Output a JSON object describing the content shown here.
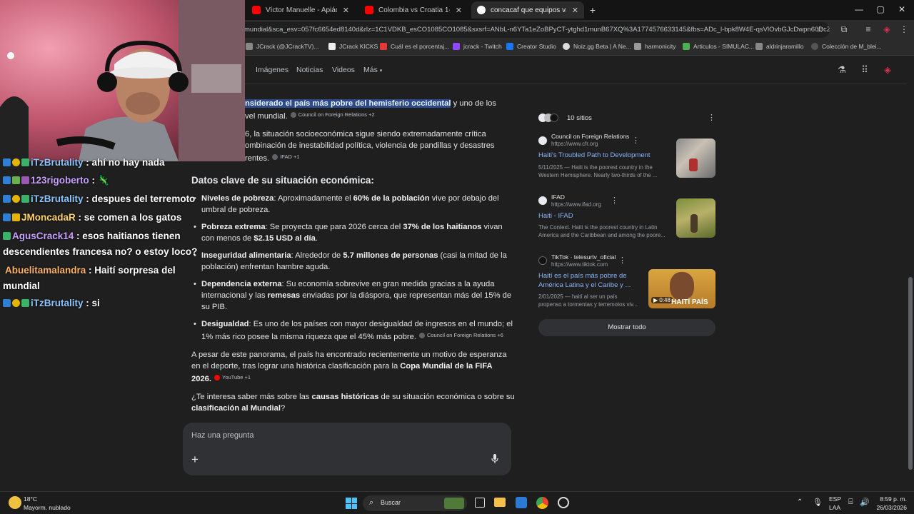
{
  "tabs": [
    {
      "title": "Víctor Manuelle - Apiádate de Mí",
      "color": "#ff0000"
    },
    {
      "title": "Colombia vs Croatia 1-2 Highlig",
      "color": "#ff0000"
    },
    {
      "title": "concacaf que equipos van al mun",
      "color": "#ffffff"
    }
  ],
  "new_tab": "+",
  "window_controls": {
    "minimize": "—",
    "maximize": "▢",
    "close": "✕"
  },
  "address": {
    "url": "mundial&sca_esv=057fc6654ed8140d&rlz=1C1VDKB_esCO1085CO1085&sxsrf=ANbL-n6YTa1eZoBPyCT-ytghd1munB67XQ%3A1774576633145&fbs=ADc_l-bpk8W4E-qsVlOvbGJcDwpn60DcZ..."
  },
  "bookmarks": [
    "JCrack (@JCrackTV)...",
    "JCrack KICKS",
    "Cuál es el porcentaj...",
    "jcrack - Twitch",
    "Creator Studio",
    "Noiz.gg Beta | A Ne...",
    "harmonicity",
    "Articulos - SIMULAC...",
    "aldrinjaramillo",
    "Colección de M_blei..."
  ],
  "google_tabs": [
    "Imágenes",
    "Noticias",
    "Videos",
    "Más"
  ],
  "answer": {
    "line1_highlight": "nsiderado el país más pobre del hemisferio occidental",
    "line1_rest": " y uno de los",
    "line2": "vel mundial.",
    "chip1": "Council on Foreign Relations +2",
    "p2_prefix": "6, la situación socioeconómica sigue siendo extremadamente crítica",
    "p2_line2": "ombinación de inestabilidad política, violencia de pandillas y desastres",
    "p2_line3": "rentes.",
    "chip2": "IFAD +1",
    "section_title": "Datos clave de su situación económica:",
    "bullets": [
      {
        "label": "Niveles de pobreza",
        "text1": ": Aproximadamente el ",
        "bold": "60% de la población",
        "text2": " vive por debajo del",
        "line2": "umbral de pobreza."
      },
      {
        "label": "Pobreza extrema",
        "text1": ": Se proyecta que para 2026 cerca del ",
        "bold": "37% de los haitianos",
        "text2": " vivan",
        "line2a": "con menos de ",
        "line2b": "$2.15 USD al día",
        "line2c": "."
      },
      {
        "label": "Inseguridad alimentaria",
        "text1": ": Alrededor de ",
        "bold": "5.7 millones de personas",
        "text2": " (casi la mitad de la",
        "line2": "población) enfrentan hambre aguda."
      },
      {
        "label": "Dependencia externa",
        "text1": ": Su economía sobrevive en gran medida gracias a la ayuda",
        "line2a": "internacional y las ",
        "line2b": "remesas",
        "line2c": " enviadas por la diáspora, que representan más del 15% de",
        "line3": "su PIB."
      },
      {
        "label": "Desigualdad",
        "text1": ": Es uno de los países con mayor desigualdad de ingresos en el mundo; el",
        "line2": "1% más rico posee la misma riqueza que el 45% más pobre.",
        "chip": "Council on Foreign Relations +6"
      }
    ],
    "p3_line1": "A pesar de este panorama, el país ha encontrado recientemente un motivo de esperanza",
    "p3_line2a": "en el deporte, tras lograr una histórica clasificación para la ",
    "p3_line2b": "Copa Mundial de la FIFA",
    "p3_line3": "2026.",
    "chip3": "YouTube +1",
    "q_line1a": "¿Te interesa saber más sobre las ",
    "q_line1b": "causas históricas",
    "q_line1c": " de su situación económica o sobre su",
    "q_line2a": "clasificación al Mundial",
    "q_line2b": "?"
  },
  "ask": {
    "placeholder": "Haz una pregunta",
    "plus": "+"
  },
  "sources": {
    "count_label": "10 sitios",
    "items": [
      {
        "site": "Council on Foreign Relations",
        "url": "https://www.cfr.org",
        "title1": "Haiti's Troubled Path to Development",
        "title2": "",
        "snip1": "5/11/2025 — Haiti is the poorest country in the",
        "snip2": "Western Hemisphere. Nearly two-thirds of the ..."
      },
      {
        "site": "IFAD",
        "url": "https://www.ifad.org",
        "title1": "Haiti - IFAD",
        "title2": "",
        "snip1": "The Context. Haiti is the poorest country in Latin",
        "snip2": "America and the Caribbean and among the poore..."
      },
      {
        "site": "TikTok · telesurtv_oficial",
        "url": "https://www.tiktok.com",
        "title1": "Haití es el país más pobre de",
        "title2": "América Latina y el Caribe y ...",
        "snip1": "2/01/2025 — haití al ser un país",
        "snip2": "propenso a tormentas y terremotos viv...",
        "duration": "0:48",
        "thumb_text": "HAITÍ PAÍS"
      }
    ],
    "show_all": "Mostrar todo"
  },
  "chat": [
    {
      "user": "iTzBrutality",
      "msg": "ahí no hay nada",
      "color": "#8ec5ff"
    },
    {
      "user": "123rigoberto",
      "msg": "",
      "color": "#c9a0ff"
    },
    {
      "user": "iTzBrutality",
      "msg": "despues del terremoto",
      "color": "#8ec5ff"
    },
    {
      "user": "JMoncadaR",
      "msg": "se comen a los gatos",
      "color": "#ffd36b"
    },
    {
      "user": "AgusCrack14",
      "msg": "esos haitianos tienen",
      "msg2": "descendientes francesa no? o estoy loco?",
      "color": "#c9a0ff"
    },
    {
      "user": "Abuelitamalandra",
      "msg": "Haití sorpresa del",
      "msg2": "mundial",
      "color": "#ffb366"
    },
    {
      "user": "iTzBrutality",
      "msg": "si",
      "color": "#8ec5ff"
    }
  ],
  "taskbar": {
    "weather_temp": "18°C",
    "weather_desc": "Mayorm. nublado",
    "search": "Buscar",
    "lang1": "ESP",
    "lang2": "LAA",
    "time": "8:59 p. m.",
    "date": "26/03/2026"
  }
}
